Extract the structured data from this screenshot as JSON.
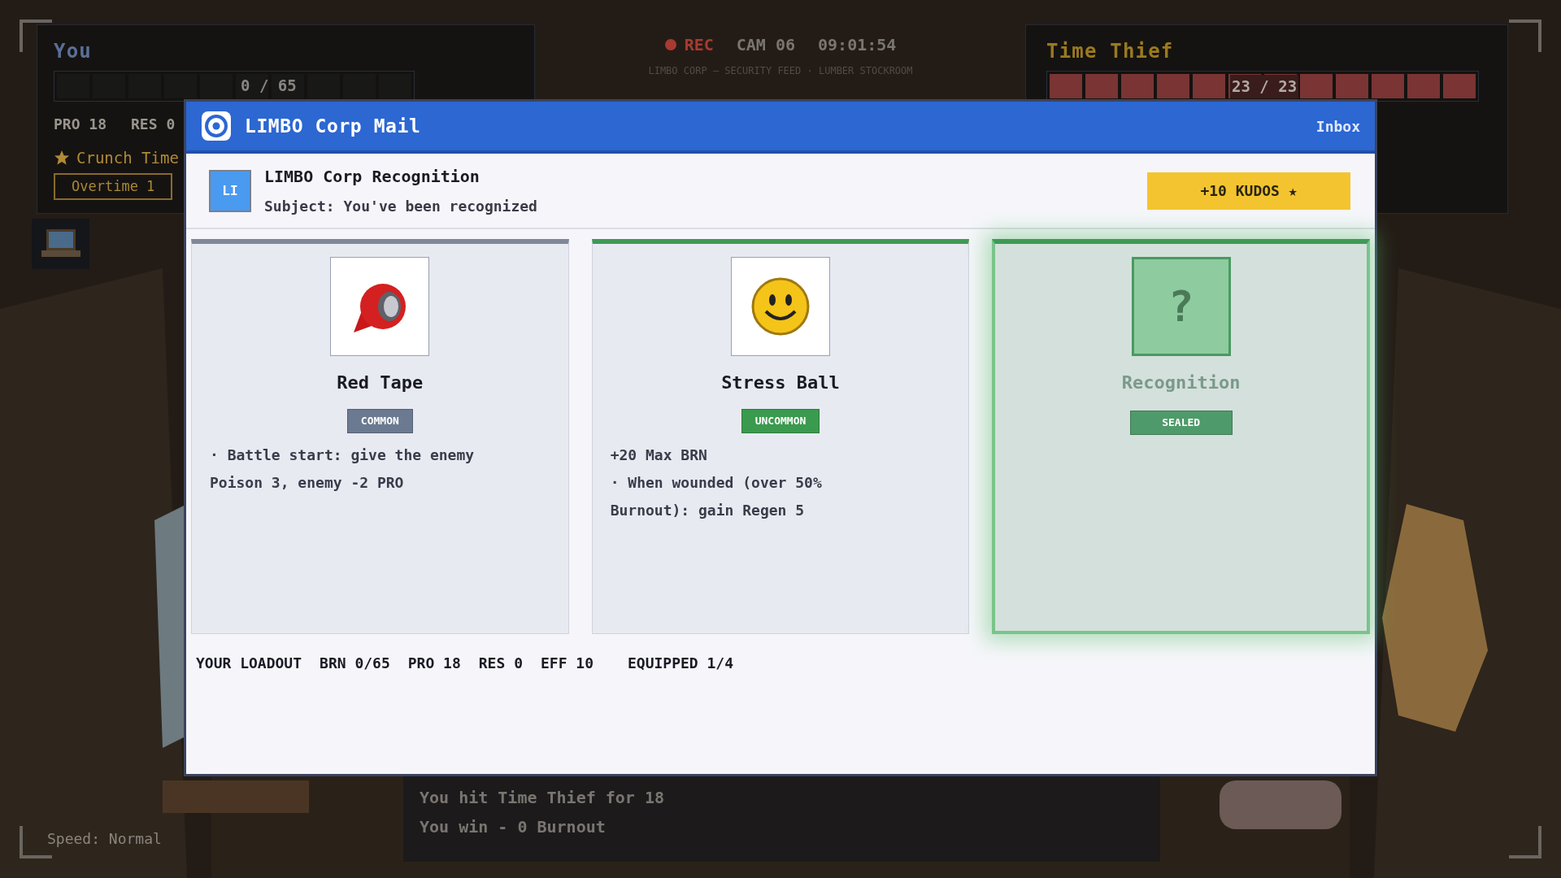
{
  "camera": {
    "rec": "REC",
    "cam": "CAM 06",
    "time": "09:01:54",
    "subtitle": "LIMBO CORP – SECURITY FEED · LUMBER STOCKROOM"
  },
  "player": {
    "name": "You",
    "hp": "0 / 65",
    "level": 0,
    "stats": [
      "PRO 18",
      "RES 0"
    ],
    "trait": "Crunch Time",
    "badge": "Overtime 1"
  },
  "enemy": {
    "name": "Time Thief",
    "hp": "23 / 23",
    "level": 1
  },
  "mail": {
    "app_title": "LIMBO Corp Mail",
    "folder": "Inbox",
    "avatar": "LI",
    "sender": "LIMBO Corp Recognition",
    "subject": "Subject: You've been recognized",
    "reward": "+10 KUDOS ★"
  },
  "rewards": [
    {
      "kind": "tape",
      "name": "Red Tape",
      "rarity": "COMMON",
      "color": "#6b7a90",
      "selected": false,
      "lines": [
        "· Battle start: give the enemy",
        "Poison 3, enemy -2 PRO"
      ]
    },
    {
      "kind": "ball",
      "name": "Stress Ball",
      "rarity": "UNCOMMON",
      "color": "#3a9a4e",
      "selected": false,
      "lines": [
        "+20 Max BRN",
        "· When wounded (over 50%",
        "Burnout): gain Regen 5"
      ]
    },
    {
      "kind": "sealed",
      "name": "Recognition",
      "rarity": "SEALED",
      "color": "#4f9a6a",
      "selected": true,
      "glyph": "?"
    }
  ],
  "loadout": [
    "YOUR LOADOUT",
    "BRN 0/65",
    "PRO 18",
    "RES 0",
    "EFF 10",
    "EQUIPPED 1/4"
  ],
  "log": [
    "You hit Time Thief for 18",
    "You win - 0 Burnout"
  ],
  "speed": "Speed: Normal"
}
